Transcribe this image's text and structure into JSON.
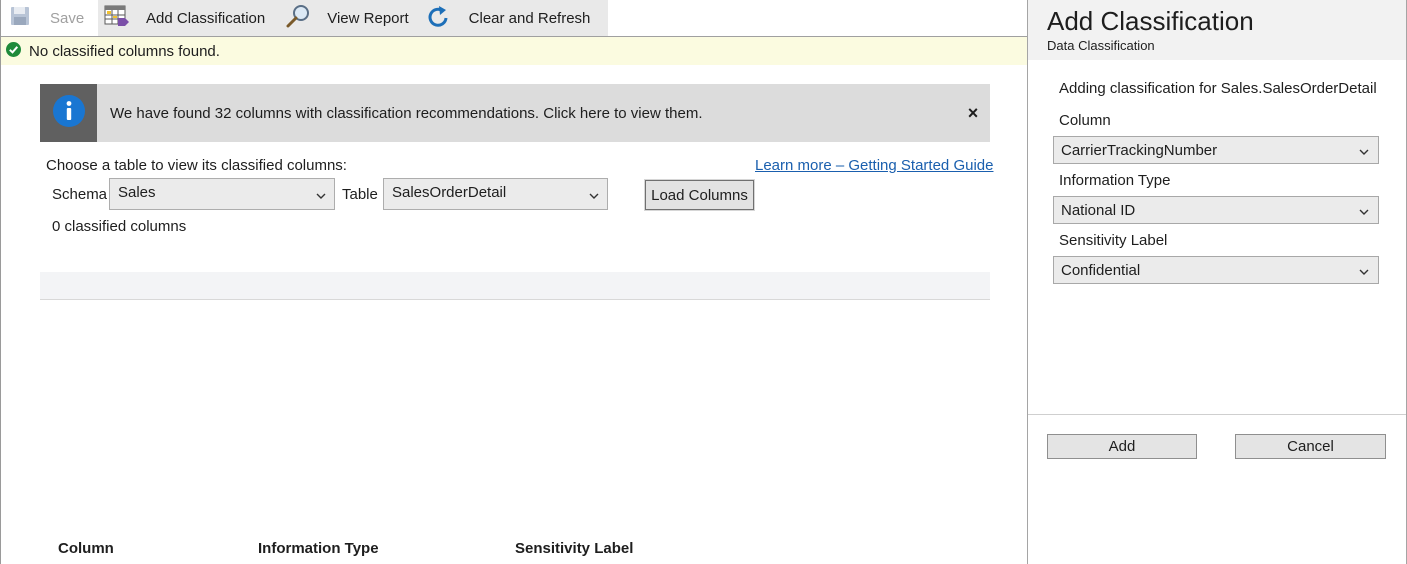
{
  "toolbar": {
    "save_label": "Save",
    "add_classification_label": "Add Classification",
    "view_report_label": "View Report",
    "clear_refresh_label": "Clear and Refresh"
  },
  "status": {
    "message": "No classified columns found.",
    "color": "#1e8a3a"
  },
  "info_banner": {
    "message": "We have found 32 columns with classification recommendations. Click here to view them.",
    "close_glyph": "×",
    "icon_color": "#1976d2"
  },
  "filter": {
    "prompt": "Choose a table to view its classified columns:",
    "learn_more_link": "Learn more – Getting Started Guide",
    "schema_label": "Schema",
    "schema_value": "Sales",
    "table_label": "Table",
    "table_value": "SalesOrderDetail",
    "load_button": "Load Columns",
    "classified_count": "0 classified columns"
  },
  "grid": {
    "headers": [
      "Column",
      "Information Type",
      "Sensitivity Label"
    ],
    "rows": []
  },
  "side_panel": {
    "title": "Add Classification",
    "subtitle": "Data Classification",
    "adding_text": "Adding classification for Sales.SalesOrderDetail",
    "column_label": "Column",
    "column_value": "CarrierTrackingNumber",
    "info_type_label": "Information Type",
    "info_type_value": "National ID",
    "sensitivity_label": "Sensitivity Label",
    "sensitivity_value": "Confidential",
    "add_button": "Add",
    "cancel_button": "Cancel"
  }
}
